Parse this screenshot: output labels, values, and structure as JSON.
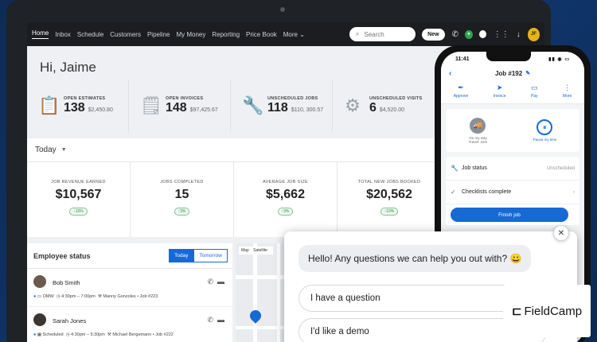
{
  "nav": {
    "items": [
      "Home",
      "Inbox",
      "Schedule",
      "Customers",
      "Pipeline",
      "My Money",
      "Reporting",
      "Price Book",
      "More"
    ],
    "search_placeholder": "Search",
    "new_label": "New",
    "avatar_initials": "JF"
  },
  "greeting": "Hi, Jaime",
  "summary": [
    {
      "label": "OPEN ESTIMATES",
      "count": "138",
      "amount": "$2,450.80",
      "icon": "clipboard-icon"
    },
    {
      "label": "OPEN INVOICES",
      "count": "148",
      "amount": "$97,425.67",
      "icon": "invoice-icon"
    },
    {
      "label": "UNSCHEDULED JOBS",
      "count": "118",
      "amount": "$110, 300.57",
      "icon": "wrench-icon"
    },
    {
      "label": "UNSCHEDULED VISITS",
      "count": "6",
      "amount": "$4,520.00",
      "icon": "visit-icon"
    }
  ],
  "today": {
    "label": "Today",
    "metrics": [
      {
        "label": "JOB REVENUE EARNED",
        "value": "$10,567",
        "badge": "↑10%"
      },
      {
        "label": "JOBS COMPLETED",
        "value": "15",
        "badge": "↑3%"
      },
      {
        "label": "AVERAGE JOB SIZE",
        "value": "$5,662",
        "badge": "↑3%"
      },
      {
        "label": "TOTAL NEW JOBS BOOKED",
        "value": "$20,562",
        "badge": "↑10%"
      }
    ]
  },
  "employee": {
    "title": "Employee status",
    "tab_today": "Today",
    "tab_tomorrow": "Tomorrow",
    "rows": [
      {
        "name": "Bob Smith",
        "status": "OMW",
        "time": "4:30pm – 7:00pm",
        "job": "Manny Gonzoles • Job #223"
      },
      {
        "name": "Sarah Jones",
        "status": "Scheduled",
        "time": "4:30pm – 5:30pm",
        "job": "Michael Bergemann • Job #222"
      }
    ]
  },
  "map": {
    "tab_map": "Map",
    "tab_satellite": "Satellite"
  },
  "phone": {
    "time": "11:41",
    "job_title": "Job #192",
    "actions": [
      "Approve",
      "Invoice",
      "Pay",
      "More"
    ],
    "on_my_way": "On my way",
    "travel": "Travel: 22m",
    "pause": "Pause my time",
    "job_status_label": "Job status",
    "job_status_value": "Unscheduled",
    "checklists": "Checklists complete",
    "finish": "Finish job"
  },
  "chat": {
    "message": "Hello! Any questions we can help you out with? 😀",
    "option1": "I have a question",
    "option2": "I'd like a demo"
  },
  "brand": {
    "name": "FieldCamp"
  }
}
